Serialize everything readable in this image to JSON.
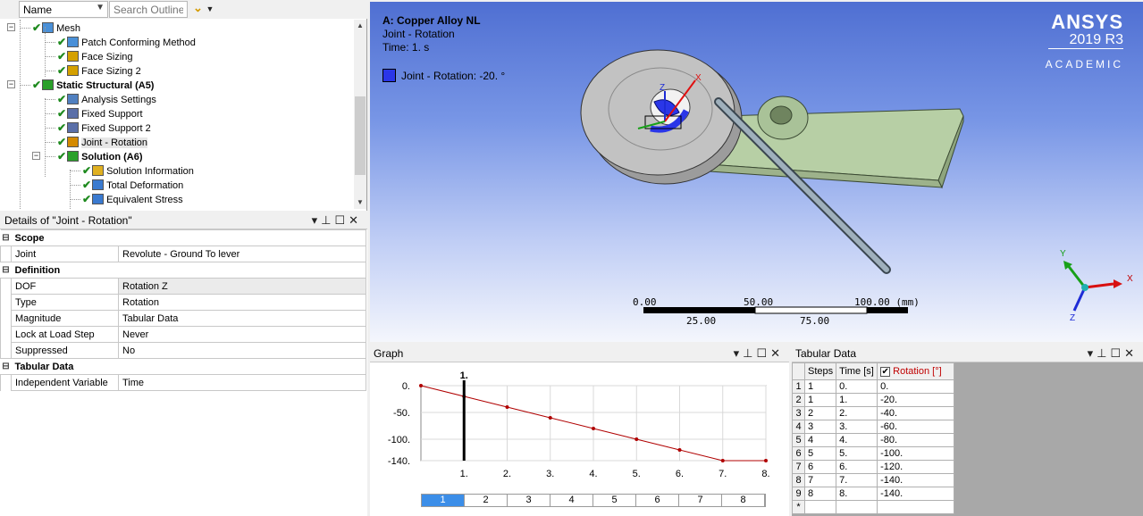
{
  "outline": {
    "name_dropdown": "Name",
    "search_placeholder": "Search Outline",
    "tree": [
      {
        "label": "Mesh",
        "level": 1,
        "bold": false
      },
      {
        "label": "Patch Conforming Method",
        "level": 2,
        "bold": false
      },
      {
        "label": "Face Sizing",
        "level": 2,
        "bold": false
      },
      {
        "label": "Face Sizing 2",
        "level": 2,
        "bold": false
      },
      {
        "label": "Static Structural (A5)",
        "level": 1,
        "bold": true
      },
      {
        "label": "Analysis Settings",
        "level": 2,
        "bold": false
      },
      {
        "label": "Fixed Support",
        "level": 2,
        "bold": false
      },
      {
        "label": "Fixed Support 2",
        "level": 2,
        "bold": false
      },
      {
        "label": "Joint - Rotation",
        "level": 2,
        "bold": false
      },
      {
        "label": "Solution (A6)",
        "level": 2,
        "bold": true
      },
      {
        "label": "Solution Information",
        "level": 3,
        "bold": false
      },
      {
        "label": "Total Deformation",
        "level": 3,
        "bold": false
      },
      {
        "label": "Equivalent Stress",
        "level": 3,
        "bold": false
      }
    ]
  },
  "details": {
    "title": "Details of \"Joint - Rotation\"",
    "groups": [
      {
        "name": "Scope",
        "rows": [
          {
            "key": "Joint",
            "value": "Revolute - Ground To lever"
          }
        ]
      },
      {
        "name": "Definition",
        "rows": [
          {
            "key": "DOF",
            "value": "Rotation Z"
          },
          {
            "key": "Type",
            "value": "Rotation"
          },
          {
            "key": "Magnitude",
            "value": "Tabular Data"
          },
          {
            "key": "Lock at Load Step",
            "value": "Never"
          },
          {
            "key": "Suppressed",
            "value": "No"
          }
        ]
      },
      {
        "name": "Tabular Data",
        "rows": [
          {
            "key": "Independent Variable",
            "value": "Time"
          }
        ]
      }
    ]
  },
  "viewport": {
    "model_title": "A: Copper Alloy NL",
    "object": "Joint - Rotation",
    "time": "Time: 1. s",
    "legend": "Joint - Rotation: -20. °",
    "legend_color": "#2a36e8",
    "logo_brand": "ANSYS",
    "logo_version": "2019 R3",
    "logo_edition": "ACADEMIC",
    "scalebar_top": [
      "0.00",
      "50.00",
      "100.00 (mm)"
    ],
    "scalebar_bottom": [
      "25.00",
      "75.00"
    ],
    "triad": {
      "x": "X",
      "y": "Y",
      "z": "Z"
    },
    "joint_triad": {
      "x": "X",
      "z": "Z"
    }
  },
  "graph": {
    "title": "Graph",
    "marker_label": "1.",
    "steps": [
      "1",
      "2",
      "3",
      "4",
      "5",
      "6",
      "7",
      "8"
    ],
    "active_step": 1
  },
  "chart_data": {
    "type": "line",
    "x": [
      0,
      1,
      2,
      3,
      4,
      5,
      6,
      7,
      8
    ],
    "series": [
      {
        "values": [
          0,
          -20,
          -40,
          -60,
          -80,
          -100,
          -120,
          -140,
          -140
        ]
      }
    ],
    "xticks": [
      "1.",
      "2.",
      "3.",
      "4.",
      "5.",
      "6.",
      "7.",
      "8."
    ],
    "yticks": [
      "0.",
      "-50.",
      "-100.",
      "-140."
    ],
    "xlim": [
      0,
      8
    ],
    "ylim": [
      -140,
      0
    ],
    "line_color": "#b00000"
  },
  "tabular": {
    "title": "Tabular Data",
    "headers": [
      "Steps",
      "Time [s]",
      "Rotation [°]"
    ],
    "rows": [
      {
        "n": "1",
        "step": "1",
        "time": "0.",
        "rot": "0."
      },
      {
        "n": "2",
        "step": "1",
        "time": "1.",
        "rot": "-20."
      },
      {
        "n": "3",
        "step": "2",
        "time": "2.",
        "rot": "-40."
      },
      {
        "n": "4",
        "step": "3",
        "time": "3.",
        "rot": "-60."
      },
      {
        "n": "5",
        "step": "4",
        "time": "4.",
        "rot": "-80."
      },
      {
        "n": "6",
        "step": "5",
        "time": "5.",
        "rot": "-100."
      },
      {
        "n": "7",
        "step": "6",
        "time": "6.",
        "rot": "-120."
      },
      {
        "n": "8",
        "step": "7",
        "time": "7.",
        "rot": "-140."
      },
      {
        "n": "9",
        "step": "8",
        "time": "8.",
        "rot": "-140."
      }
    ],
    "new_row_marker": "*"
  }
}
